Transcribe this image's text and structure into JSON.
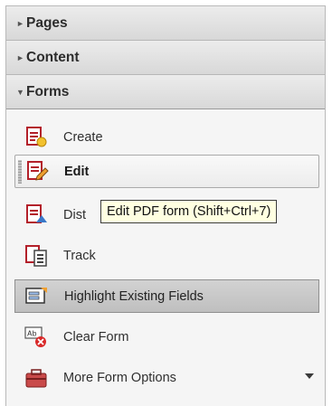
{
  "sections": {
    "pages": {
      "label": "Pages",
      "expanded": false
    },
    "content": {
      "label": "Content",
      "expanded": false
    },
    "forms": {
      "label": "Forms",
      "expanded": true
    }
  },
  "forms": {
    "items": [
      {
        "label": "Create",
        "icon": "create-form-icon"
      },
      {
        "label": "Edit",
        "icon": "edit-form-icon",
        "state": "hover"
      },
      {
        "label": "Dist",
        "icon": "distribute-form-icon"
      },
      {
        "label": "Track",
        "icon": "track-form-icon"
      },
      {
        "label": "Highlight Existing Fields",
        "icon": "highlight-fields-icon",
        "state": "toggled-on"
      },
      {
        "label": "Clear Form",
        "icon": "clear-form-icon"
      },
      {
        "label": "More Form Options",
        "icon": "toolbox-icon",
        "has_dropdown": true
      }
    ]
  },
  "tooltip": {
    "text": "Edit PDF form (Shift+Ctrl+7)"
  },
  "colors": {
    "accent_red": "#c0282d",
    "tooltip_bg": "#ffffe1"
  }
}
